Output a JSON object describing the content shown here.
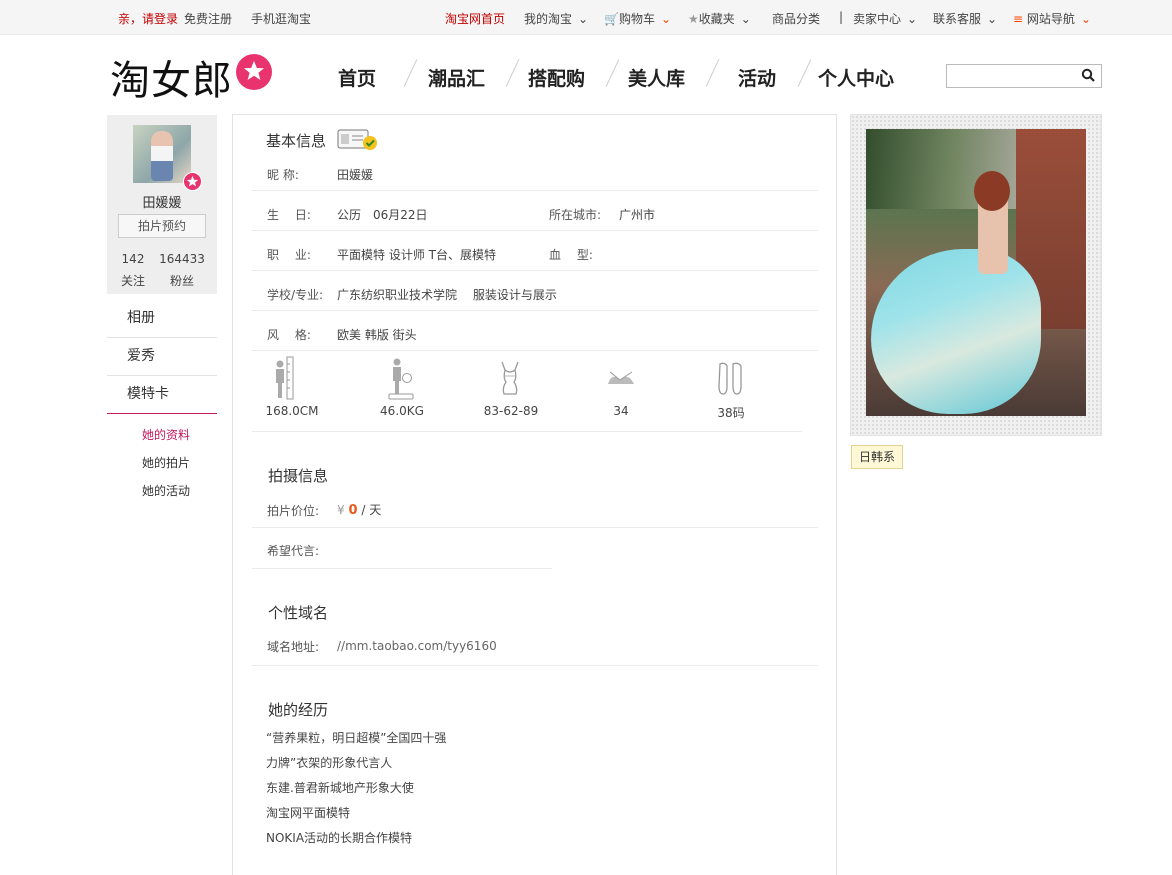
{
  "topbar": {
    "greeting": "亲，请登录",
    "register": "免费注册",
    "mobile": "手机逛淘宝",
    "taobao_home": "淘宝网首页",
    "my_taobao": "我的淘宝",
    "cart": "购物车",
    "favorites": "收藏夹",
    "categories": "商品分类",
    "seller_center": "卖家中心",
    "customer_service": "联系客服",
    "site_nav": "网站导航"
  },
  "header": {
    "logo_text": "淘女郎",
    "nav": [
      "首页",
      "潮品汇",
      "搭配购",
      "美人库",
      "活动",
      "个人中心"
    ],
    "search": {
      "value": "",
      "placeholder": ""
    }
  },
  "profile": {
    "name": "田媛媛",
    "book_button": "拍片预约",
    "following_count": "142",
    "following_label": "关注",
    "fans_count": "164433",
    "fans_label": "粉丝"
  },
  "sidenav": {
    "items": [
      "相册",
      "爱秀",
      "模特卡"
    ],
    "sub_items": [
      "她的资料",
      "她的拍片",
      "她的活动"
    ]
  },
  "basic_info": {
    "title": "基本信息",
    "nickname_label": "昵 称:",
    "nickname": "田媛媛",
    "birthday_label": "生　 日:",
    "birthday": "公历　06月22日",
    "city_label": "所在城市:",
    "city": "广州市",
    "job_label": "职　 业:",
    "job": "平面模特 设计师 T台、展模特",
    "blood_label": "血　 型:",
    "blood": "",
    "school_label": "学校/专业:",
    "school": "广东纺织职业技术学院　 服装设计与展示",
    "style_label": "风　 格:",
    "style": "欧美 韩版 街头",
    "stats": [
      {
        "icon": "height-icon",
        "value": "168.0CM"
      },
      {
        "icon": "weight-icon",
        "value": "46.0KG"
      },
      {
        "icon": "measurements-icon",
        "value": "83-62-89"
      },
      {
        "icon": "cup-size-icon",
        "value": "34"
      },
      {
        "icon": "shoe-size-icon",
        "value": "38码"
      }
    ]
  },
  "shoot_info": {
    "title": "拍摄信息",
    "price_label": "拍片价位:",
    "price_currency": "¥",
    "price_value": "0",
    "price_unit": "/ 天",
    "endorse_label": "希望代言:",
    "endorse": ""
  },
  "domain_info": {
    "title": "个性域名",
    "label": "域名地址:",
    "url": "//mm.taobao.com/tyy6160"
  },
  "experience": {
    "title": "她的经历",
    "items": [
      "“营养果粒，明日超模”全国四十强",
      "力牌”衣架的形象代言人",
      "东建.普君新城地产形象大使",
      "淘宝网平面模特",
      "NOKIA活动的长期合作模特"
    ]
  },
  "right": {
    "tag": "日韩系"
  },
  "colors": {
    "brand_pink": "#e8336e",
    "accent_red": "#c40000",
    "active_purple": "#c2185b",
    "price_orange": "#e85a1b"
  }
}
